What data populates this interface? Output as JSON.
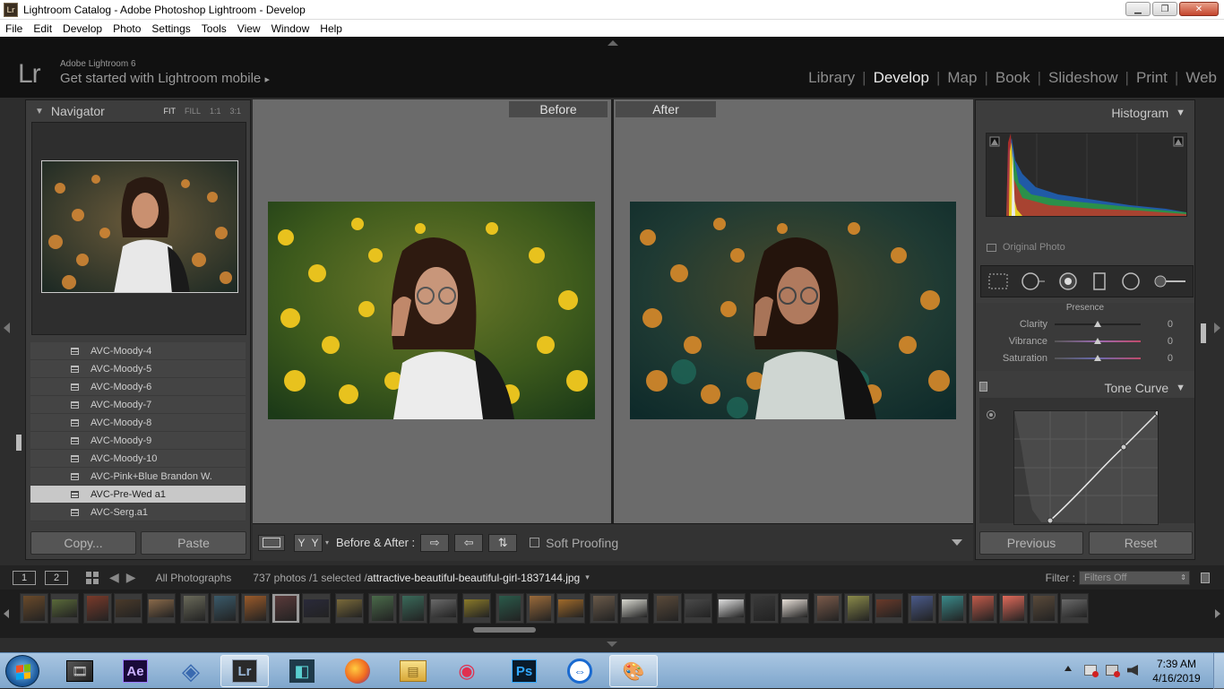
{
  "window": {
    "app_icon": "Lr",
    "title": "Lightroom Catalog - Adobe Photoshop Lightroom - Develop",
    "controls": [
      "▁",
      "❐",
      "✕"
    ]
  },
  "menu": [
    "File",
    "Edit",
    "Develop",
    "Photo",
    "Settings",
    "Tools",
    "View",
    "Window",
    "Help"
  ],
  "identity": {
    "logo": "Lr",
    "product": "Adobe Lightroom 6",
    "mobile": "Get started with Lightroom mobile",
    "mobile_arrow": "▸"
  },
  "modules": [
    {
      "label": "Library",
      "active": false
    },
    {
      "label": "Develop",
      "active": true
    },
    {
      "label": "Map",
      "active": false
    },
    {
      "label": "Book",
      "active": false
    },
    {
      "label": "Slideshow",
      "active": false
    },
    {
      "label": "Print",
      "active": false
    },
    {
      "label": "Web",
      "active": false
    }
  ],
  "navigator": {
    "title": "Navigator",
    "collapse": "▼",
    "zoom_options": [
      "FIT",
      "FILL",
      "1:1",
      "3:1"
    ],
    "active_zoom": "FIT"
  },
  "presets": [
    {
      "label": "AVC-Moody-4",
      "selected": false
    },
    {
      "label": "AVC-Moody-5",
      "selected": false
    },
    {
      "label": "AVC-Moody-6",
      "selected": false
    },
    {
      "label": "AVC-Moody-7",
      "selected": false
    },
    {
      "label": "AVC-Moody-8",
      "selected": false
    },
    {
      "label": "AVC-Moody-9",
      "selected": false
    },
    {
      "label": "AVC-Moody-10",
      "selected": false
    },
    {
      "label": "AVC-Pink+Blue Brandon W.",
      "selected": false
    },
    {
      "label": "AVC-Pre-Wed a1",
      "selected": true
    },
    {
      "label": "AVC-Serg.a1",
      "selected": false
    }
  ],
  "left_buttons": {
    "copy": "Copy...",
    "paste": "Paste"
  },
  "compare": {
    "before_label": "Before",
    "after_label": "After"
  },
  "toolbar": {
    "yy": [
      "Y",
      "Y"
    ],
    "dropdown": "▾",
    "before_after_label": "Before & After :",
    "arrows": [
      "⇨",
      "⇦",
      "⇅"
    ],
    "soft_proofing": "Soft Proofing",
    "expand": "▼"
  },
  "histogram": {
    "title": "Histogram",
    "collapse": "▼",
    "original_photo": "Original Photo"
  },
  "presence": {
    "title": "Presence",
    "rows": [
      {
        "label": "Clarity",
        "value": "0"
      },
      {
        "label": "Vibrance",
        "value": "0"
      },
      {
        "label": "Saturation",
        "value": "0"
      }
    ]
  },
  "tone_curve": {
    "title": "Tone Curve",
    "collapse": "▼"
  },
  "right_buttons": {
    "previous": "Previous",
    "reset": "Reset"
  },
  "filmstrip_bar": {
    "monitor1": "1",
    "monitor2": "2",
    "nav_back": "◀",
    "nav_fwd": "▶",
    "source": "All Photographs",
    "count": "737 photos /1 selected /",
    "filename": "attractive-beautiful-beautiful-girl-1837144.jpg",
    "dropdown": "▾",
    "filter_label": "Filter :",
    "filter_value": "Filters Off",
    "filter_updown": "⇕"
  },
  "taskbar": {
    "apps": [
      {
        "name": "windows-movie-maker",
        "glyph": "🎞",
        "active": false
      },
      {
        "name": "after-effects",
        "glyph": "Ae",
        "active": false
      },
      {
        "name": "network-app",
        "glyph": "◈",
        "active": false
      },
      {
        "name": "lightroom",
        "glyph": "Lr",
        "active": true
      },
      {
        "name": "filmora",
        "glyph": "◧",
        "active": false
      },
      {
        "name": "firefox",
        "glyph": "●",
        "active": false
      },
      {
        "name": "file-explorer",
        "glyph": "▤",
        "active": false
      },
      {
        "name": "screen-recorder",
        "glyph": "◉",
        "active": false
      },
      {
        "name": "photoshop",
        "glyph": "Ps",
        "active": false
      },
      {
        "name": "teamviewer",
        "glyph": "⇔",
        "active": false
      },
      {
        "name": "paint",
        "glyph": "🎨",
        "active": true
      }
    ],
    "time": "7:39 AM",
    "date": "4/16/2019"
  }
}
